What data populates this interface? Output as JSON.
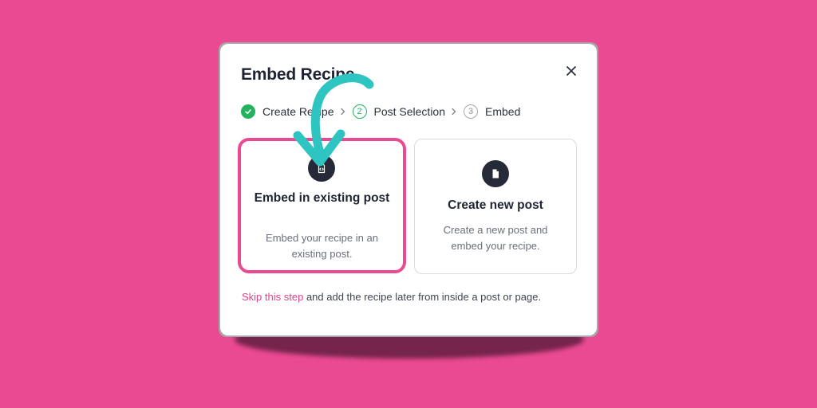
{
  "dialog": {
    "title": "Embed Recipe",
    "close_icon": "close-icon"
  },
  "steps": [
    {
      "label": "Create Recipe",
      "status": "done",
      "icon": "check-icon"
    },
    {
      "number": "2",
      "label": "Post Selection",
      "status": "active"
    },
    {
      "number": "3",
      "label": "Embed",
      "status": "pending"
    }
  ],
  "options": {
    "existing": {
      "icon": "embed-code-icon",
      "title": "Embed in existing post",
      "description": "Embed your recipe in an existing post."
    },
    "new_post": {
      "icon": "document-icon",
      "title": "Create new post",
      "description": "Create a new post and embed your recipe."
    }
  },
  "footer": {
    "skip_link": "Skip this step",
    "text": " and add the recipe later from inside a post or page."
  },
  "colors": {
    "background": "#ea4a91",
    "accent_pink": "#ea4a91",
    "step_green": "#22b35e",
    "annotation_arrow": "#2ec4c1"
  }
}
